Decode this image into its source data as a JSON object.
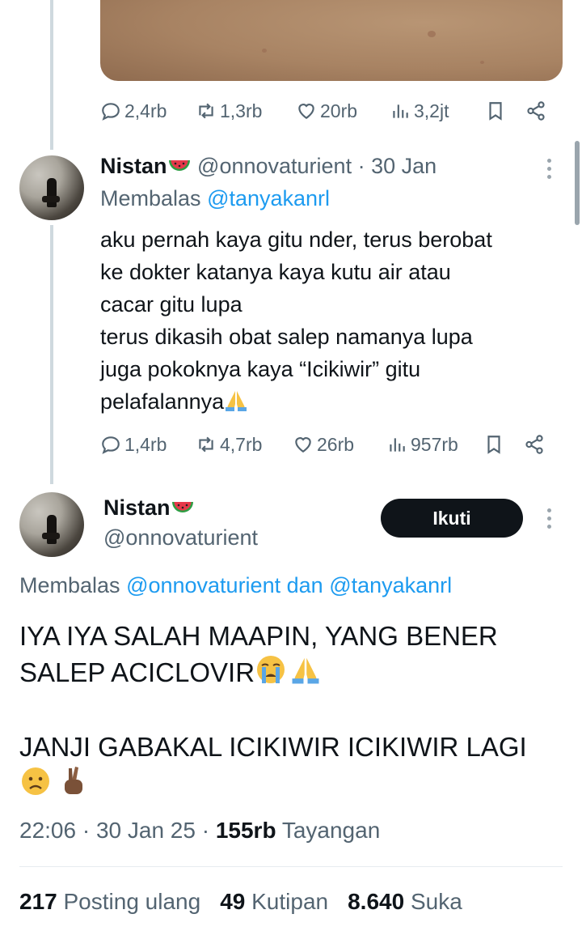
{
  "tweet1": {
    "stats": {
      "replies": "2,4rb",
      "reposts": "1,3rb",
      "likes": "20rb",
      "views": "3,2jt"
    }
  },
  "tweet2": {
    "name": "Nistan",
    "handle_date": "@onnovaturient · 30 Jan",
    "replying_prefix": "Membalas",
    "replying_to": "@tanyakanrl",
    "lines": [
      "aku pernah kaya gitu nder, terus berobat",
      "ke dokter katanya kaya kutu air atau",
      "cacar gitu lupa",
      "terus dikasih obat salep namanya lupa",
      "juga pokoknya kaya “Icikiwir” gitu",
      "pelafalannya"
    ],
    "stats": {
      "replies": "1,4rb",
      "reposts": "4,7rb",
      "likes": "26rb",
      "views": "957rb"
    }
  },
  "tweet3": {
    "name": "Nistan",
    "handle": "@onnovaturient",
    "follow_label": "Ikuti",
    "replying_prefix": "Membalas",
    "replying_to_1": "@onnovaturient",
    "replying_and": "dan",
    "replying_to_2": "@tanyakanrl",
    "line1": "IYA IYA SALAH MAAPIN, YANG BENER",
    "line2": "SALEP ACICLOVIR",
    "line3": "JANJI GABAKAL ICIKIWIR ICIKIWIR LAGI",
    "time": "22:06 · 30 Jan 25 ·",
    "views_count": "155rb",
    "views_label": "Tayangan",
    "reposts_count": "217",
    "reposts_label": "Posting ulang",
    "quotes_count": "49",
    "quotes_label": "Kutipan",
    "likes_count": "8.640",
    "likes_label": "Suka"
  },
  "icons": [
    "reply-icon",
    "repost-icon",
    "like-icon",
    "views-icon",
    "bookmark-icon",
    "share-icon",
    "more-icon",
    "watermelon-emoji",
    "praying-hands-emoji",
    "crying-face-emoji",
    "worried-face-emoji",
    "crossed-fingers-emoji"
  ]
}
